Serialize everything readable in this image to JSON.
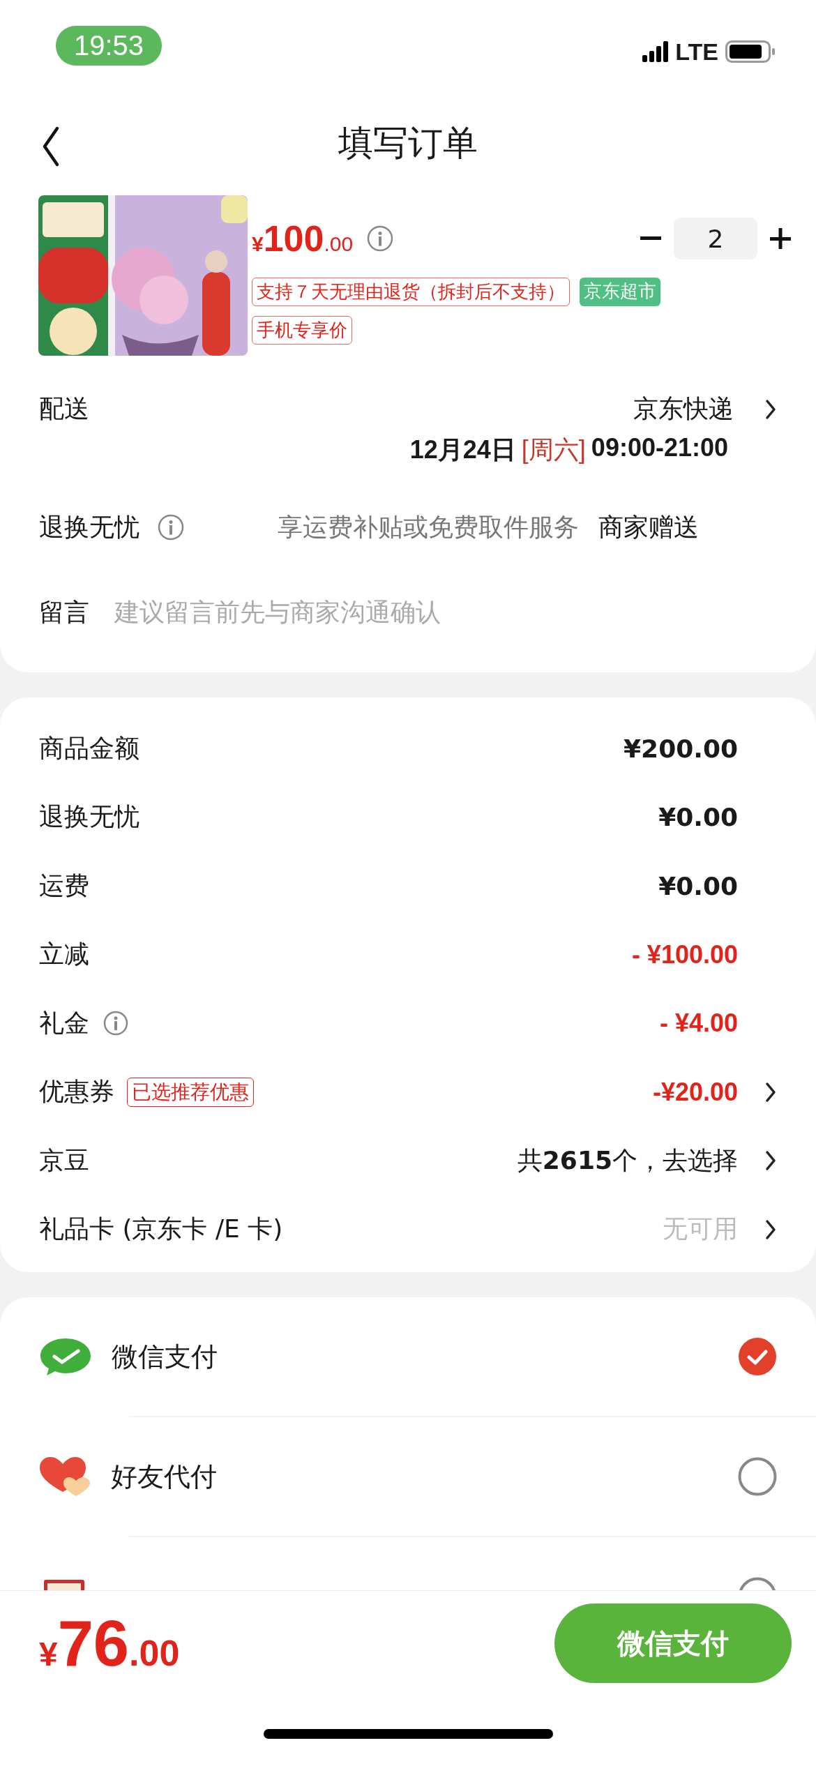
{
  "status_bar": {
    "time": "19:53",
    "network": "LTE"
  },
  "nav": {
    "title": "填写订单"
  },
  "product": {
    "currency": "¥",
    "price_main": "100",
    "price_decimal": ".00",
    "quantity": "2",
    "tags": [
      {
        "text": "支持７天无理由退货（拆封后不支持）",
        "kind": "outline"
      },
      {
        "text": "京东超市",
        "kind": "filled"
      },
      {
        "text": "手机专享价",
        "kind": "outline"
      }
    ]
  },
  "delivery": {
    "label": "配送",
    "method": "京东快递",
    "date": "12月24日",
    "weekday": "[周六]",
    "time": "09:00-21:00"
  },
  "return_service": {
    "label": "退换无忧",
    "description": "享运费补贴或免费取件服务",
    "value": "商家赠送"
  },
  "message": {
    "label": "留言",
    "placeholder": "建议留言前先与商家沟通确认"
  },
  "summary": [
    {
      "label": "商品金额",
      "value": "¥200.00",
      "kind": "amount",
      "info": false,
      "chevron": false
    },
    {
      "label": "退换无忧",
      "value": "¥0.00",
      "kind": "amount",
      "info": false,
      "chevron": false
    },
    {
      "label": "运费",
      "value": "¥0.00",
      "kind": "amount",
      "info": false,
      "chevron": false
    },
    {
      "label": "立减",
      "value": "- ¥100.00",
      "kind": "discount",
      "info": false,
      "chevron": false
    },
    {
      "label": "礼金",
      "value": "- ¥4.00",
      "kind": "discount",
      "info": true,
      "chevron": false
    },
    {
      "label": "优惠券",
      "tag": "已选推荐优惠",
      "value": "-¥20.00",
      "kind": "discount",
      "info": false,
      "chevron": true
    },
    {
      "label": "京豆",
      "value": "共**2615**个，去选择",
      "kind": "choice",
      "info": false,
      "chevron": true
    },
    {
      "label": "礼品卡 (京东卡 /E 卡)",
      "value": "无可用",
      "kind": "unavailable",
      "info": false,
      "chevron": true
    }
  ],
  "payments": [
    {
      "name": "微信支付",
      "kind": "wechat",
      "selected": true
    },
    {
      "name": "好友代付",
      "kind": "friend",
      "selected": false
    },
    {
      "kind": "card",
      "selected": false
    }
  ],
  "footer": {
    "currency": "¥",
    "total_main": "76",
    "total_decimal": ".00",
    "pay_button": "微信支付"
  }
}
